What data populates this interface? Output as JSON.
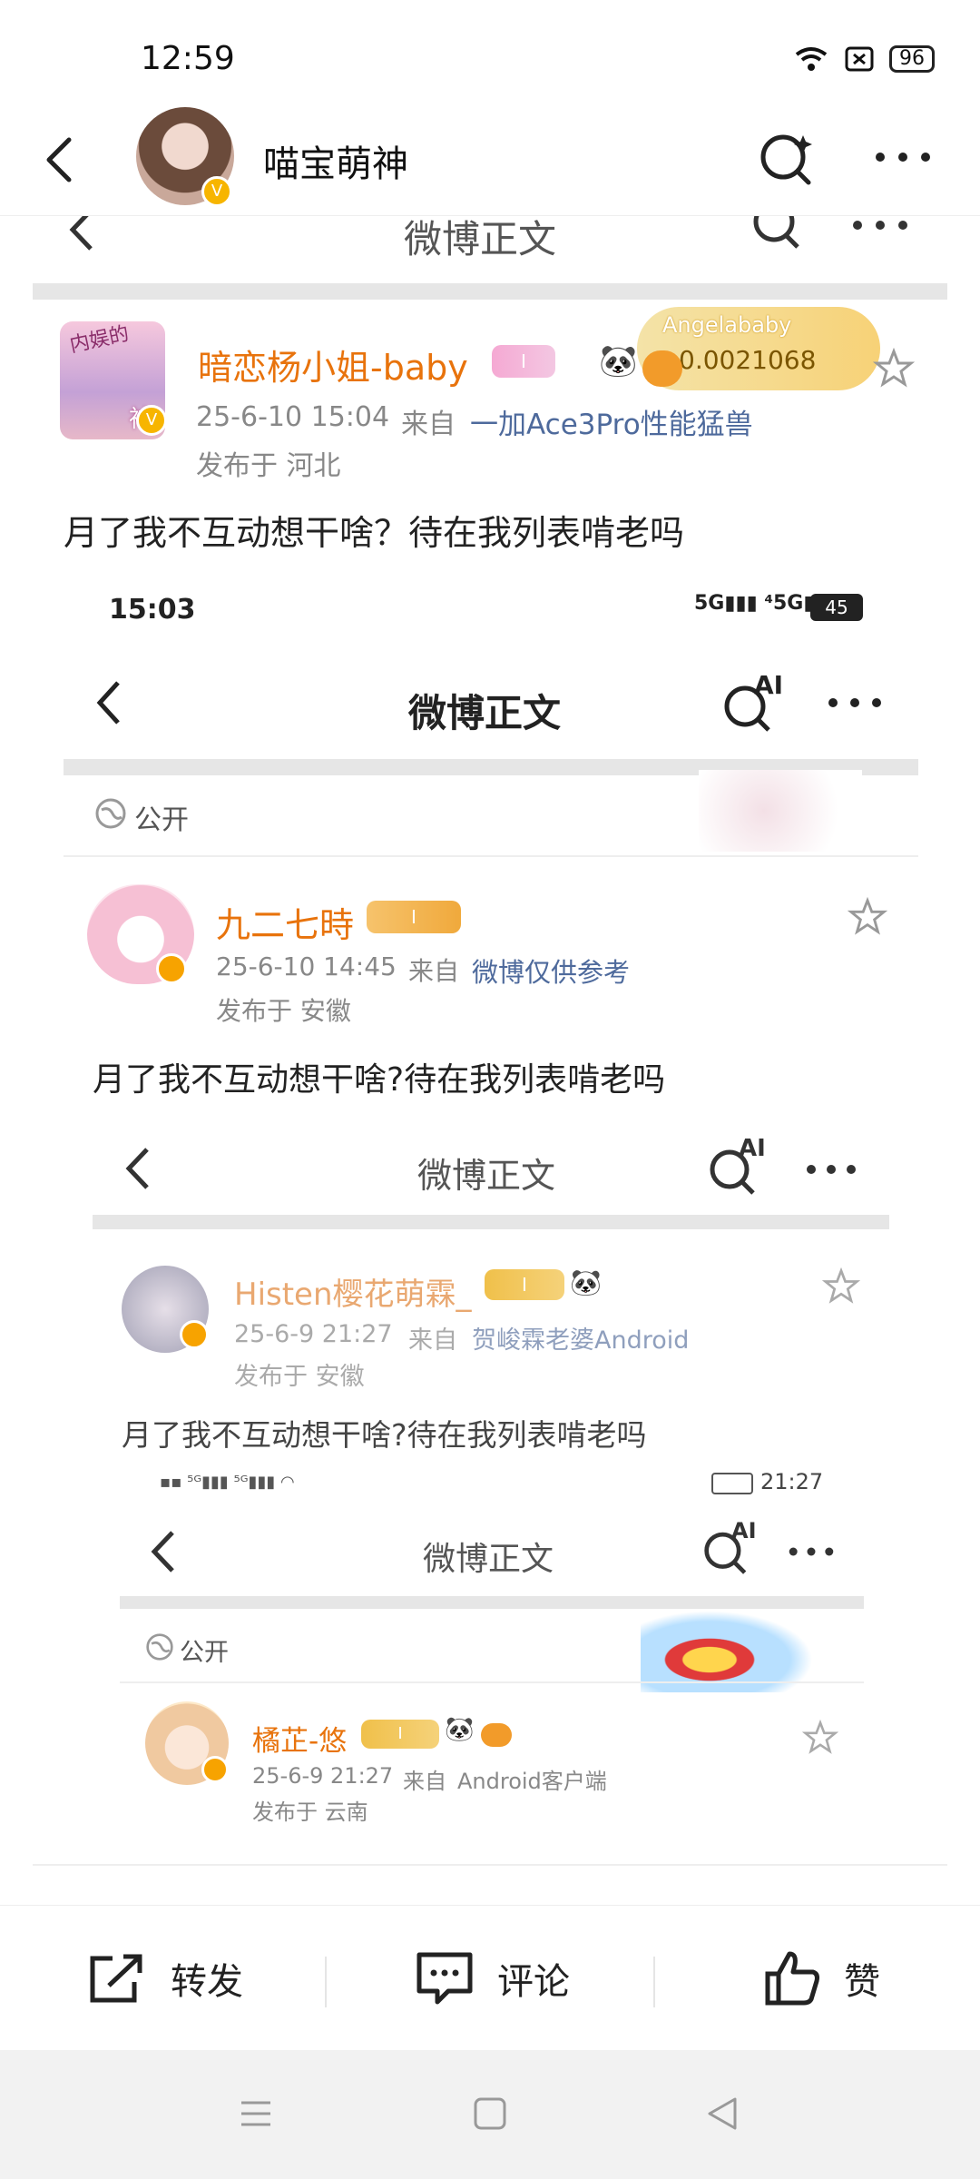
{
  "status_bar": {
    "time": "12:59",
    "battery": "96"
  },
  "nav": {
    "title": "喵宝萌神"
  },
  "layer1": {
    "header_title": "微博正文",
    "username": "暗恋杨小姐-baby",
    "avatar_text_top": "内娱的",
    "avatar_text_bottom": "神",
    "coin_name": "Angelababy",
    "coin_value": "0.0021068",
    "date": "25-6-10 15:04",
    "from_label": "来自",
    "source": "一加Ace3Pro性能猛兽",
    "location": "发布于 河北",
    "text": "月了我不互动想干啥？待在我列表啃老吗"
  },
  "layer2": {
    "status_time": "15:03",
    "status_battery": "45",
    "header_title": "微博正文",
    "public_label": "公开",
    "username": "九二七時",
    "date": "25-6-10 14:45",
    "from_label": "来自",
    "source": "微博仅供参考",
    "location": "发布于 安徽",
    "text": "月了我不互动想干啥?待在我列表啃老吗"
  },
  "layer3": {
    "header_title": "微博正文",
    "username": "Histen樱花萌霖_",
    "date": "25-6-9 21:27",
    "from_label": "来自",
    "source": "贺峻霖老婆Android",
    "location": "发布于 安徽",
    "text": "月了我不互动想干啥?待在我列表啃老吗",
    "status_time": "21:27"
  },
  "layer4": {
    "header_title": "微博正文",
    "public_label": "公开",
    "username": "橘芷-悠",
    "date": "25-6-9 21:27",
    "from_label": "来自",
    "source": "Android客户端",
    "location": "发布于 云南"
  },
  "actions": {
    "repost": "转发",
    "comment": "评论",
    "like": "赞"
  },
  "ai_label": "AI",
  "level_badge": "I"
}
